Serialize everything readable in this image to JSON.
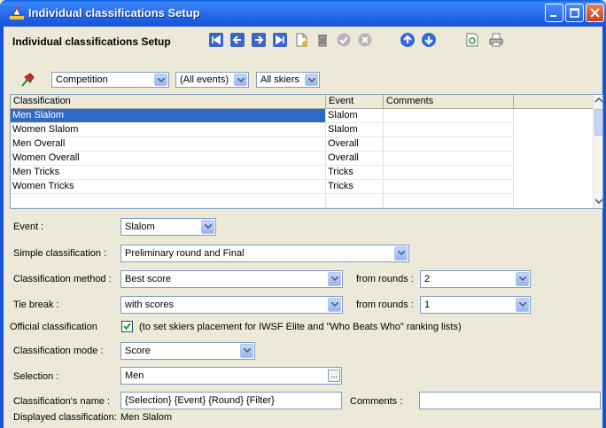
{
  "window": {
    "title": "Individual classifications Setup"
  },
  "toolbar": {
    "title": "Individual classifications Setup",
    "icons": [
      "first-icon",
      "prev-icon",
      "next-icon",
      "last-icon",
      "new-icon",
      "delete-icon",
      "confirm-icon",
      "cancel-icon",
      "up-icon",
      "down-icon",
      "preview-icon",
      "print-icon"
    ]
  },
  "filters": {
    "competition": "Competition",
    "events": "(All events)",
    "skiers": "All skiers"
  },
  "grid": {
    "headers": [
      "Classification",
      "Event",
      "Comments"
    ],
    "rows": [
      [
        "Men Slalom",
        "Slalom",
        ""
      ],
      [
        "Women Slalom",
        "Slalom",
        ""
      ],
      [
        "Men Overall",
        "Overall",
        ""
      ],
      [
        "Women Overall",
        "Overall",
        ""
      ],
      [
        "Men Tricks",
        "Tricks",
        ""
      ],
      [
        "Women Tricks",
        "Tricks",
        ""
      ]
    ]
  },
  "form": {
    "event_label": "Event :",
    "event_value": "Slalom",
    "simple_label": "Simple classification :",
    "simple_value": "Preliminary round and Final",
    "method_label": "Classification method :",
    "method_value": "Best score",
    "from_rounds_label": "from rounds :",
    "method_rounds": "2",
    "tie_label": "Tie break :",
    "tie_value": "with scores",
    "tie_rounds": "1",
    "official_label": "Official classification",
    "official_text": "(to set skiers placement for IWSF Elite and \"Who Beats Who\" ranking lists)",
    "mode_label": "Classification mode :",
    "mode_value": "Score",
    "selection_label": "Selection :",
    "selection_value": "Men",
    "ellipsis": "...",
    "name_label": "Classification's name :",
    "name_value": "{Selection} {Event} {Round} {Filter}",
    "comments_label": "Comments :",
    "comments_value": "",
    "displayed_label": "Displayed classification:",
    "displayed_value": "Men Slalom"
  },
  "colors": {
    "titlebar": "#1653d8",
    "selected_row": "#316ac5",
    "panel": "#ece9d8"
  }
}
